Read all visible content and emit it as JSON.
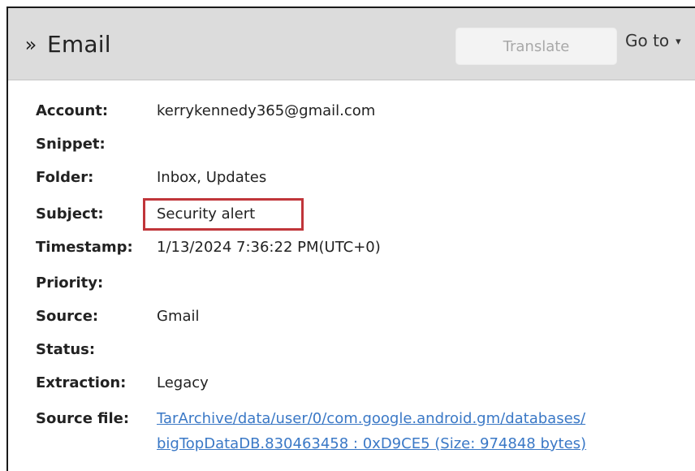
{
  "header": {
    "title": "Email",
    "translate_label": "Translate",
    "goto_label": "Go to"
  },
  "fields": {
    "account": {
      "label": "Account:",
      "value": "kerrykennedy365@gmail.com"
    },
    "snippet": {
      "label": "Snippet:",
      "value": ""
    },
    "folder": {
      "label": "Folder:",
      "value": "Inbox, Updates"
    },
    "subject": {
      "label": "Subject:",
      "value": "Security alert"
    },
    "timestamp": {
      "label": "Timestamp:",
      "value": "1/13/2024 7:36:22 PM(UTC+0)"
    },
    "priority": {
      "label": "Priority:",
      "value": ""
    },
    "source": {
      "label": "Source:",
      "value": "Gmail"
    },
    "status": {
      "label": "Status:",
      "value": ""
    },
    "extraction": {
      "label": "Extraction:",
      "value": "Legacy"
    },
    "source_file": {
      "label": "Source file:",
      "line1": "TarArchive/data/user/0/com.google.android.gm/databases/",
      "line2": "bigTopDataDB.830463458 : 0xD9CE5 (Size: 974848 bytes)"
    }
  },
  "colors": {
    "header_bg": "#dcdcdc",
    "highlight_border": "#c0353a",
    "link": "#3a78c6"
  }
}
